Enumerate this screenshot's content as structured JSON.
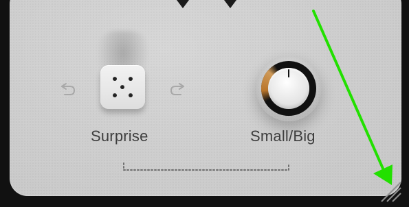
{
  "controls": {
    "surprise": {
      "label": "Surprise"
    },
    "size_knob": {
      "label": "Small/Big"
    }
  },
  "icons": {
    "undo": "undo-icon",
    "redo": "redo-icon",
    "dice": "dice-icon",
    "top_left_arrow": "chevron-left-icon",
    "top_right_arrow": "chevron-right-icon",
    "annotation_arrow": "arrow-down-right-icon",
    "resize_grip": "resize-grip-icon"
  },
  "colors": {
    "annotation_arrow": "#22e000",
    "knob_accent": "#c27a2b"
  }
}
